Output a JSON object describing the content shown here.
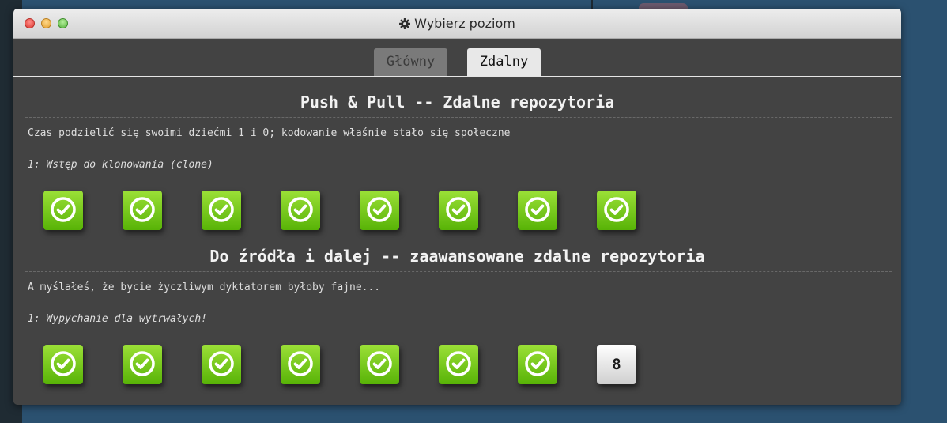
{
  "window": {
    "title": "Wybierz poziom",
    "title_icon": "gear-icon"
  },
  "tabs": [
    {
      "label": "Główny",
      "active": false
    },
    {
      "label": "Zdalny",
      "active": true
    }
  ],
  "sections": [
    {
      "title": "Push & Pull -- Zdalne repozytoria",
      "description": "Czas podzielić się swoimi dziećmi 1 i 0; kodowanie właśnie stało się społeczne",
      "sequence_label": "1: Wstęp do klonowania (clone)",
      "levels": [
        {
          "status": "solved",
          "icon": "check-icon"
        },
        {
          "status": "solved",
          "icon": "check-icon"
        },
        {
          "status": "solved",
          "icon": "check-icon"
        },
        {
          "status": "solved",
          "icon": "check-icon"
        },
        {
          "status": "solved",
          "icon": "check-icon"
        },
        {
          "status": "solved",
          "icon": "check-icon"
        },
        {
          "status": "solved",
          "icon": "check-icon"
        },
        {
          "status": "solved",
          "icon": "check-icon"
        }
      ]
    },
    {
      "title": "Do źródła i dalej -- zaawansowane zdalne repozytoria",
      "description": "A myślałeś, że bycie życzliwym dyktatorem byłoby fajne...",
      "sequence_label": "1: Wypychanie dla wytrwałych!",
      "levels": [
        {
          "status": "solved",
          "icon": "check-icon"
        },
        {
          "status": "solved",
          "icon": "check-icon"
        },
        {
          "status": "solved",
          "icon": "check-icon"
        },
        {
          "status": "solved",
          "icon": "check-icon"
        },
        {
          "status": "solved",
          "icon": "check-icon"
        },
        {
          "status": "solved",
          "icon": "check-icon"
        },
        {
          "status": "solved",
          "icon": "check-icon"
        },
        {
          "status": "unsolved",
          "number": "8"
        }
      ]
    }
  ],
  "colors": {
    "solved_tile": "#6cc21a",
    "window_body": "#434343",
    "desktop": "#2b5170"
  }
}
